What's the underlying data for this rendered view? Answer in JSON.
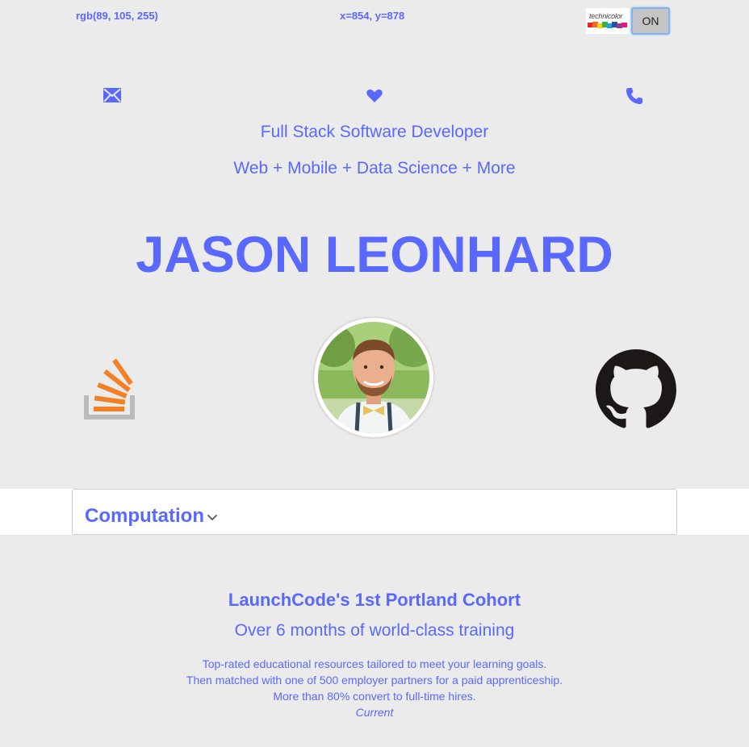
{
  "status_bar": {
    "rgb_readout": "rgb(89, 105, 255)",
    "coord_readout": "x=854, y=878",
    "logo_text": "technicolor",
    "toggle_label": "ON"
  },
  "contact_icons": [
    "mail-icon",
    "heart-icon",
    "phone-icon"
  ],
  "hero": {
    "tagline_1": "Full Stack Software Developer",
    "tagline_2": "Web + Mobile + Data Science + More",
    "name": "JASON LEONHARD"
  },
  "profile_icons": [
    "stackoverflow-icon",
    "avatar",
    "github-icon"
  ],
  "accordion": {
    "label": "Computation"
  },
  "experience": {
    "title": "LaunchCode's 1st Portland Cohort",
    "subtitle": "Over 6 months of world-class training",
    "lines": [
      "Top-rated educational resources tailored to meet your learning goals.",
      "Then matched with one of 500 employer partners for a paid apprenticeship.",
      "More than 80% convert to full-time hires."
    ],
    "status": "Current"
  },
  "colors": {
    "accent": "#5969ff",
    "background": "#ebebeb",
    "stackoverflow_orange": "#f48024",
    "stackoverflow_gray": "#bcbbbb",
    "github_black": "#1b1817"
  }
}
